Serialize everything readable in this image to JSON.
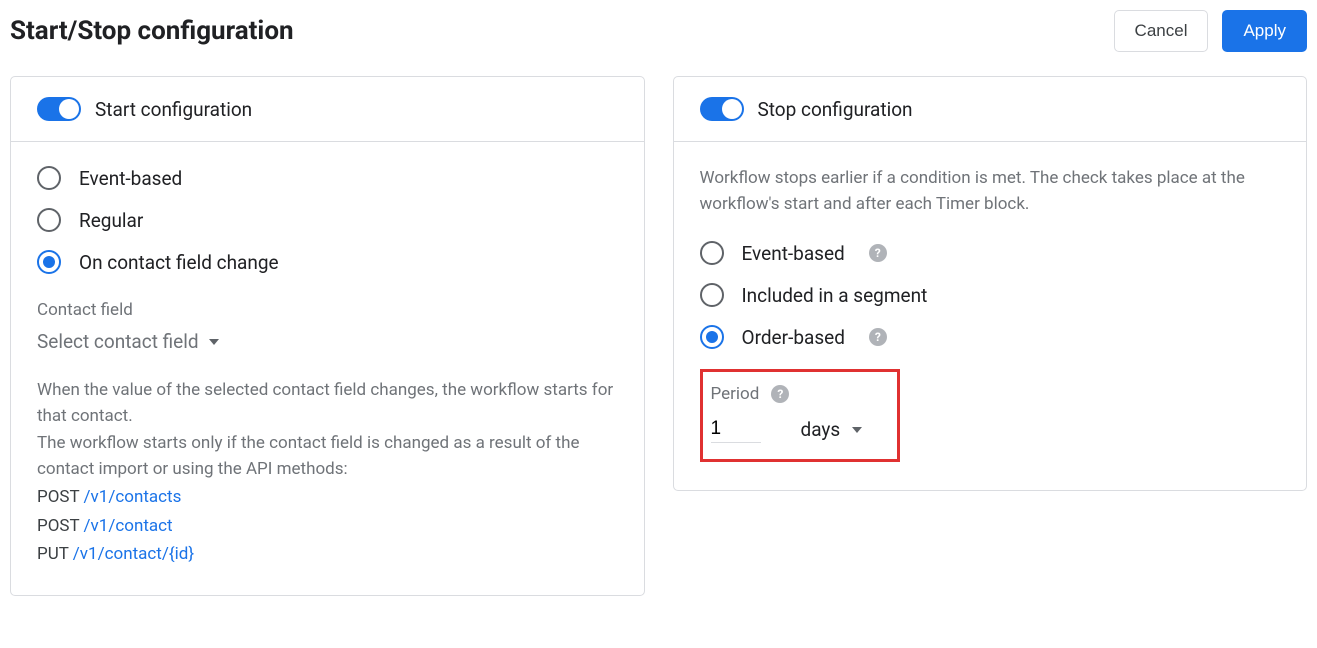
{
  "header": {
    "title": "Start/Stop configuration",
    "cancel": "Cancel",
    "apply": "Apply"
  },
  "start": {
    "title": "Start configuration",
    "options": {
      "event": "Event-based",
      "regular": "Regular",
      "change": "On contact field change"
    },
    "contact_field_label": "Contact field",
    "contact_field_placeholder": "Select contact field",
    "help": {
      "line1": "When the value of the selected contact field changes, the workflow starts for that contact.",
      "line2": "The workflow starts only if the contact field is changed as a result of the contact import or using the API methods:",
      "api": [
        {
          "method": "POST",
          "path": "/v1/contacts"
        },
        {
          "method": "POST",
          "path": "/v1/contact"
        },
        {
          "method": "PUT",
          "path": "/v1/contact/{id}"
        }
      ]
    }
  },
  "stop": {
    "title": "Stop configuration",
    "desc": "Workflow stops earlier if a condition is met. The check takes place at the workflow's start and after each Timer block.",
    "options": {
      "event": "Event-based",
      "segment": "Included in a segment",
      "order": "Order-based"
    },
    "period": {
      "label": "Period",
      "value": "1",
      "unit": "days"
    }
  }
}
